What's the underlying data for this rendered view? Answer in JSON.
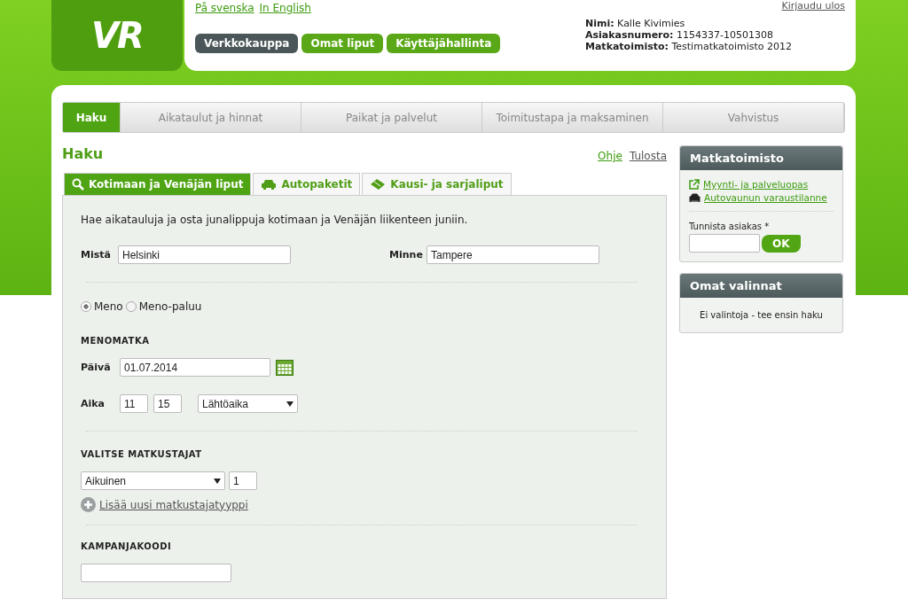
{
  "header": {
    "logo": "VR",
    "languages": [
      "På svenska",
      "In English"
    ],
    "logout": "Kirjaudu ulos",
    "nav": [
      {
        "label": "Verkkokauppa",
        "selected": true
      },
      {
        "label": "Omat liput",
        "selected": false
      },
      {
        "label": "Käyttäjähallinta",
        "selected": false
      }
    ],
    "user_info": [
      {
        "label": "Nimi:",
        "value": "Kalle Kivimies"
      },
      {
        "label": "Asiakasnumero:",
        "value": "1154337-10501308"
      },
      {
        "label": "Matkatoimisto:",
        "value": "Testimatkatoimisto 2012"
      }
    ]
  },
  "steps": [
    {
      "label": "Haku",
      "selected": true
    },
    {
      "label": "Aikataulut ja hinnat",
      "selected": false
    },
    {
      "label": "Paikat ja palvelut",
      "selected": false
    },
    {
      "label": "Toimitustapa ja maksaminen",
      "selected": false
    },
    {
      "label": "Vahvistus",
      "selected": false
    }
  ],
  "page_title": "Haku",
  "page_links": [
    "Ohje",
    "Tulosta"
  ],
  "tabs": [
    {
      "label": "Kotimaan ja Venäjän liput",
      "selected": true
    },
    {
      "label": "Autopaketit",
      "selected": false
    },
    {
      "label": "Kausi- ja sarjaliput",
      "selected": false
    }
  ],
  "form": {
    "intro": "Hae aikatauluja ja osta junalippuja kotimaan ja Venäjän liikenteen juniin.",
    "from": {
      "label": "Mistä",
      "value": "Helsinki"
    },
    "to": {
      "label": "Minne",
      "value": "Tampere"
    },
    "trip_type": [
      {
        "label": "Meno",
        "selected": true
      },
      {
        "label": "Meno-paluu",
        "selected": false
      }
    ],
    "outbound_heading": "MENOMATKA",
    "date": {
      "label": "Päivä",
      "value": "01.07.2014"
    },
    "time": {
      "label": "Aika",
      "hour": "11",
      "minute": "15",
      "mode": "Lähtöaika"
    },
    "passengers_heading": "VALITSE MATKUSTAJAT",
    "passenger_type": "Aikuinen",
    "passenger_count": "1",
    "add_passenger": "Lisää uusi matkustajatyyppi",
    "campaign_heading": "KAMPANJAKOODI"
  },
  "sidebar": {
    "agency": {
      "title": "Matkatoimisto",
      "links": [
        "Myynti- ja palveluopas",
        "Autovaunun varaustilanne"
      ],
      "identify_label": "Tunnista asiakas *",
      "ok": "OK"
    },
    "selections": {
      "title": "Omat valinnat",
      "empty": "Ei valintoja - tee ensin haku"
    }
  }
}
